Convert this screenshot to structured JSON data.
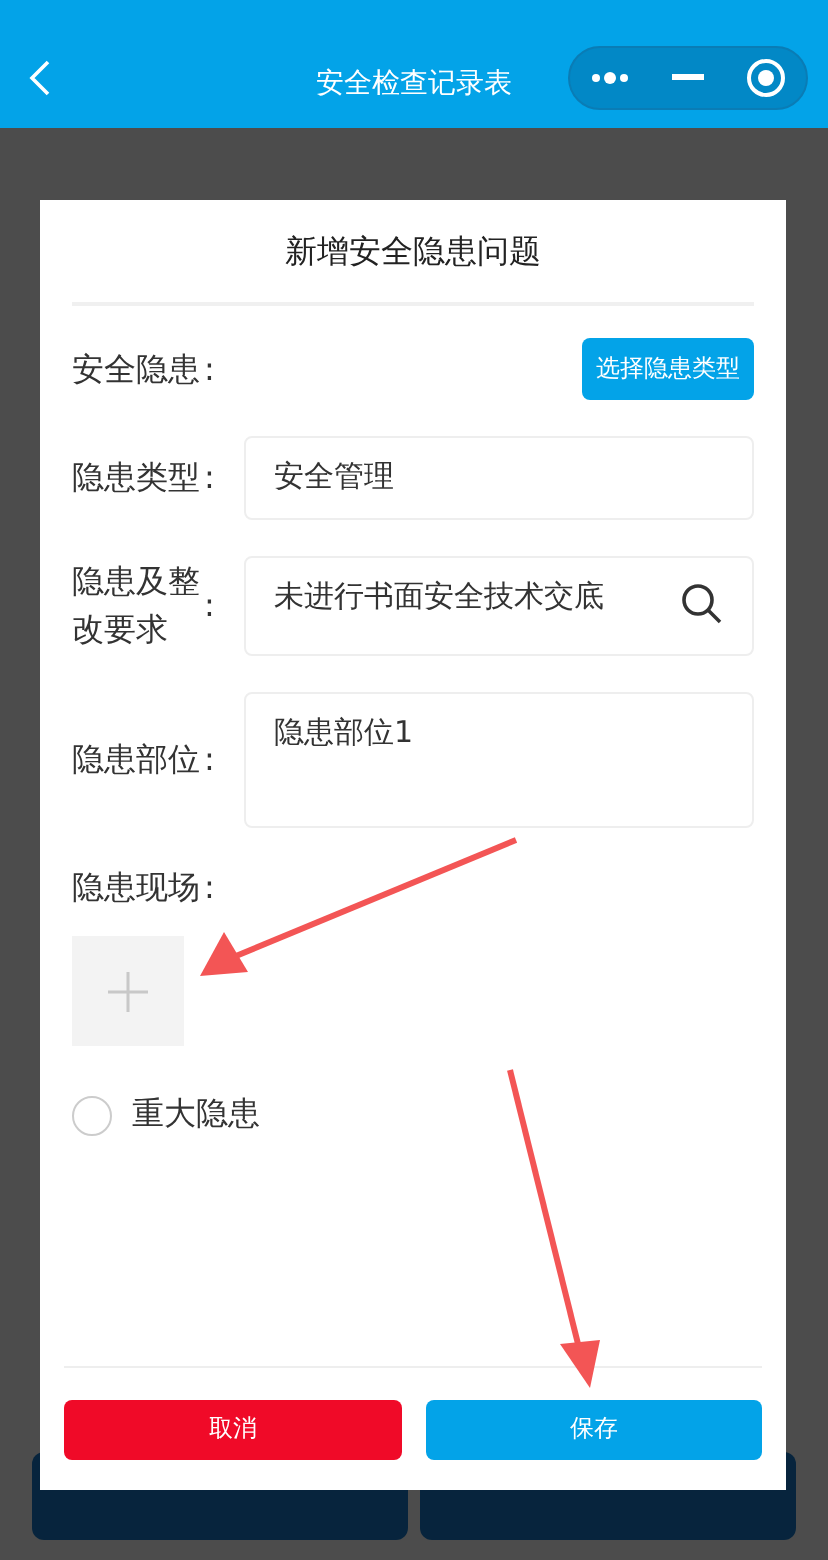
{
  "nav_bar": {
    "title": "安全检查记录表"
  },
  "dialog": {
    "title": "新增安全隐患问题",
    "rows": [
      {
        "kind": "button",
        "label": "安全隐患",
        "colon": ":",
        "button": "选择隐患类型"
      },
      {
        "kind": "text",
        "label": "隐患类型",
        "colon": ":",
        "value": "安全管理"
      },
      {
        "kind": "search",
        "label": "隐患及整改要求",
        "colon": ":",
        "value": "未进行书面安全技术交底"
      },
      {
        "kind": "textarea",
        "label": "隐患部位",
        "colon": ":",
        "value": "隐患部位1"
      },
      {
        "kind": "upload",
        "label": "隐患现场",
        "colon": ":"
      }
    ],
    "major_hazard": {
      "label": "重大隐患",
      "checked": false
    },
    "buttons": [
      {
        "kind": "cancel",
        "label": "取消"
      },
      {
        "kind": "save",
        "label": "保存"
      }
    ]
  }
}
